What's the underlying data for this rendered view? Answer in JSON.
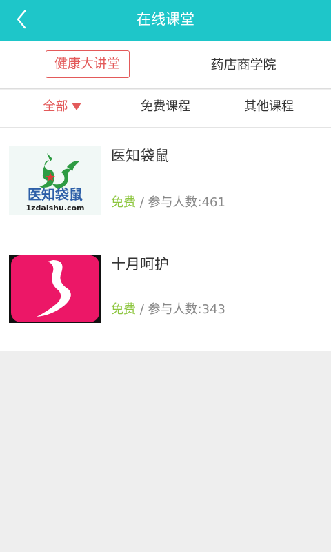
{
  "header": {
    "title": "在线课堂"
  },
  "tabs": [
    {
      "label": "健康大讲堂",
      "active": true
    },
    {
      "label": "药店商学院",
      "active": false
    }
  ],
  "filters": [
    {
      "label": "全部",
      "active": true
    },
    {
      "label": "免费课程",
      "active": false
    },
    {
      "label": "其他课程",
      "active": false
    }
  ],
  "courses": [
    {
      "title": "医知袋鼠",
      "price": "免费",
      "separator": " / ",
      "participants_label": "参与人数:",
      "participants": "461",
      "logo": {
        "text": "医知袋鼠",
        "url_text": "1zdaishu.com"
      }
    },
    {
      "title": "十月呵护",
      "price": "免费",
      "separator": " / ",
      "participants_label": "参与人数:",
      "participants": "343"
    }
  ],
  "colors": {
    "header": "#1ec6c9",
    "accent": "#e35a5a",
    "free": "#8dc63f",
    "background": "#eeeeee"
  }
}
